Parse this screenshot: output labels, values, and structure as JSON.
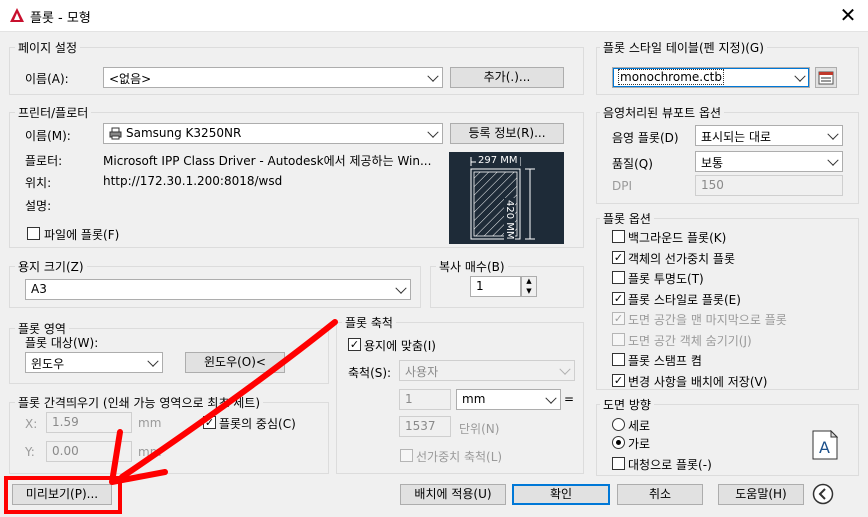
{
  "window": {
    "title": "플롯 - 모형",
    "close_glyph": "✕"
  },
  "page_setup": {
    "group_label": "페이지 설정",
    "name_label": "이름(A):",
    "name_value": "<없음>",
    "add_button": "추가(.)..."
  },
  "printer": {
    "group_label": "프린터/플로터",
    "name_label": "이름(M):",
    "name_value": "Samsung K3250NR",
    "properties_button": "등록 정보(R)...",
    "plotter_label": "플로터:",
    "plotter_value": "Microsoft IPP Class Driver - Autodesk에서 제공하는 Win...",
    "where_label": "위치:",
    "where_value": "http://172.30.1.200:8018/wsd",
    "desc_label": "설명:",
    "plot_to_file": "파일에 플롯(F)",
    "paper_width": "297 MM",
    "paper_height": "420 MM"
  },
  "paper_size": {
    "group_label": "용지 크기(Z)",
    "value": "A3"
  },
  "copies": {
    "group_label": "복사 매수(B)",
    "value": "1"
  },
  "plot_area": {
    "group_label": "플롯 영역",
    "what_label": "플롯 대상(W):",
    "what_value": "윈도우",
    "window_button": "윈도우(O)<"
  },
  "plot_offset": {
    "group_label": "플롯 간격띄우기 (인쇄 가능 영역으로 최초 세트)",
    "x_label": "X:",
    "x_value": "1.59",
    "x_unit": "mm",
    "y_label": "Y:",
    "y_value": "0.00",
    "y_unit": "mm",
    "center": "플롯의 중심(C)"
  },
  "plot_scale": {
    "group_label": "플롯 축척",
    "fit": "용지에 맞춤(I)",
    "scale_label": "축척(S):",
    "scale_value": "사용자",
    "value1": "1",
    "unit_value": "mm",
    "equals": "=",
    "value2": "1537",
    "units_label": "단위(N)",
    "lineweights": "선가중치 축척(L)"
  },
  "style_table": {
    "group_label": "플롯 스타일 테이블(펜 지정)(G)",
    "value": "monochrome.ctb"
  },
  "shaded": {
    "group_label": "음영처리된 뷰포트 옵션",
    "shade_label": "음영 플롯(D)",
    "shade_value": "표시되는 대로",
    "quality_label": "품질(Q)",
    "quality_value": "보통",
    "dpi_label": "DPI",
    "dpi_value": "150"
  },
  "plot_options": {
    "group_label": "플롯 옵션",
    "items": [
      {
        "label": "백그라운드 플롯(K)",
        "checked": false,
        "disabled": false
      },
      {
        "label": "객체의 선가중치 플롯",
        "checked": true,
        "disabled": false
      },
      {
        "label": "플롯 투명도(T)",
        "checked": false,
        "disabled": false
      },
      {
        "label": "플롯 스타일로 플롯(E)",
        "checked": true,
        "disabled": false
      },
      {
        "label": "도면 공간을 맨 마지막으로 플롯",
        "checked": true,
        "disabled": true
      },
      {
        "label": "도면 공간 객체 숨기기(J)",
        "checked": false,
        "disabled": true
      },
      {
        "label": "플롯 스탬프 켬",
        "checked": false,
        "disabled": false
      },
      {
        "label": "변경 사항을 배치에 저장(V)",
        "checked": true,
        "disabled": false
      }
    ]
  },
  "orientation": {
    "group_label": "도면 방향",
    "portrait": "세로",
    "landscape": "가로",
    "upside_down": "대청으로 플롯(-)",
    "selected": "landscape"
  },
  "buttons": {
    "preview": "미리보기(P)...",
    "apply_layout": "배치에 적용(U)",
    "ok": "확인",
    "cancel": "취소",
    "help": "도움말(H)"
  },
  "colors": {
    "accent": "#0078d7",
    "annotation": "#ff0000",
    "preview_bg": "#1e2b38"
  },
  "icons": [
    "autocad-app-icon",
    "printer-icon",
    "edit-style-table-icon",
    "landscape-page-icon",
    "collapse-arrow-icon"
  ]
}
